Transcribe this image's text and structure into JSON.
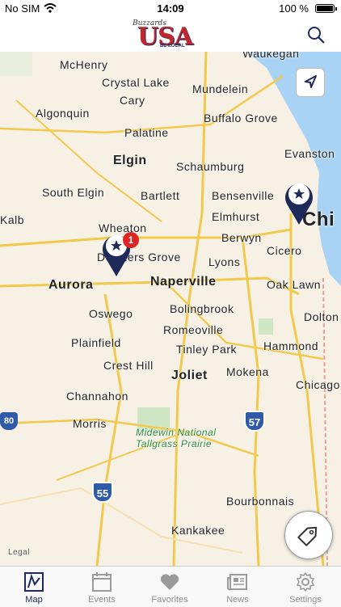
{
  "status": {
    "carrier": "No SIM",
    "time": "14:09",
    "battery": "100 %"
  },
  "header": {
    "logo_subtitle": "Buzzards",
    "logo_word": "USA",
    "logo_tag": "BE LOCAL"
  },
  "map": {
    "labels": [
      "McHenry",
      "Crystal Lake",
      "Cary",
      "Algonquin",
      "Mundelein",
      "Buffalo Grove",
      "Palatine",
      "Evanston",
      "Elgin",
      "Schaumburg",
      "South Elgin",
      "Bartlett",
      "Bensenville",
      "Elmhurst",
      "Wheaton",
      "Downers Grove",
      "Berwyn",
      "Cicero",
      "Lyons",
      "Aurora",
      "Naperville",
      "Oak Lawn",
      "Oswego",
      "Bolingbrook",
      "Romeoville",
      "Plainfield",
      "Tinley Park",
      "Hammond",
      "Crest Hill",
      "Joliet",
      "Mokena",
      "Chicago",
      "Channahon",
      "Morris",
      "Midewin National",
      "Tallgrass Prairie",
      "Bourbonnais",
      "Kankakee",
      "Waukegan",
      "Kalb",
      "Chi",
      "Dolton"
    ],
    "shields": [
      "80",
      "57",
      "55"
    ],
    "pin_badge": "1",
    "legal": "Legal"
  },
  "tabs": [
    {
      "label": "Map",
      "icon": "map-icon",
      "active": true
    },
    {
      "label": "Events",
      "icon": "calendar-icon",
      "active": false
    },
    {
      "label": "Favorites",
      "icon": "heart-icon",
      "active": false
    },
    {
      "label": "News",
      "icon": "newspaper-icon",
      "active": false
    },
    {
      "label": "Settings",
      "icon": "gear-icon",
      "active": false
    }
  ],
  "colors": {
    "brand_navy": "#1e2a5a",
    "brand_red": "#c0262d",
    "water": "#a9d3f5",
    "badge": "#e02424"
  }
}
